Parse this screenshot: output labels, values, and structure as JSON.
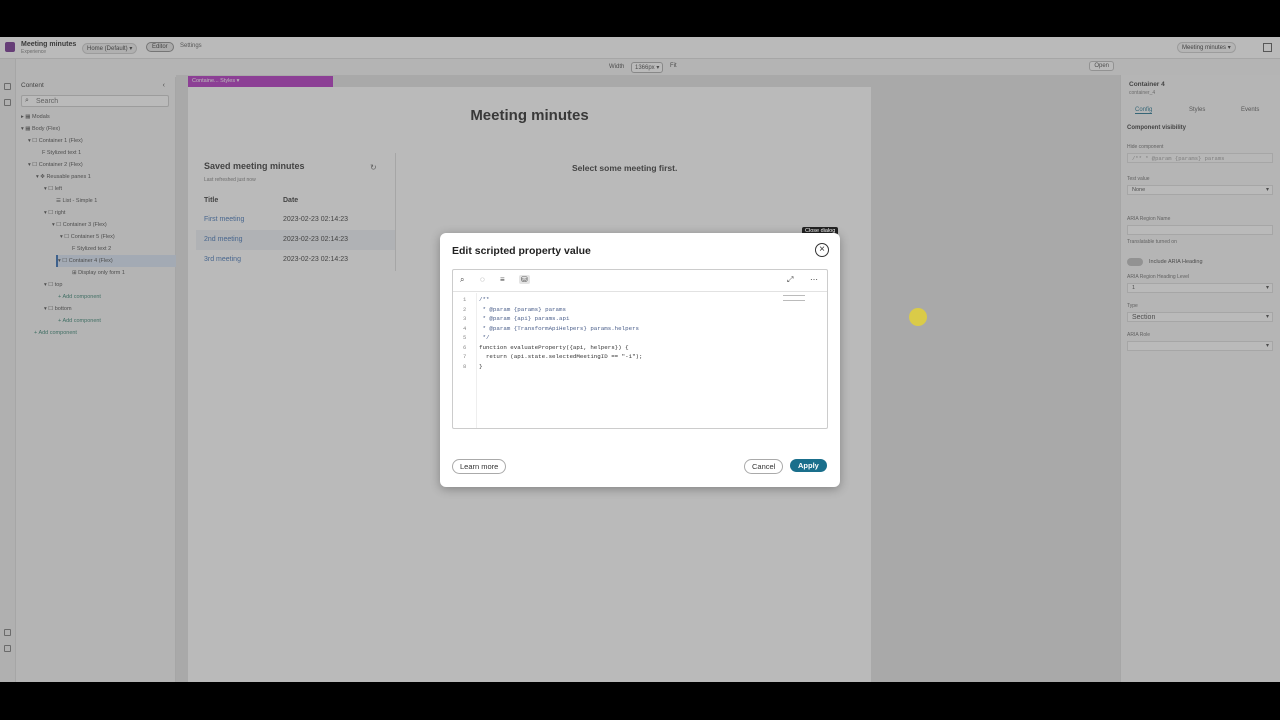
{
  "topbar": {
    "app_title": "Meeting minutes",
    "app_sub": "Experience",
    "page_select": "Home (Default) ▾",
    "tab_editor": "Editor",
    "tab_settings": "Settings",
    "right_select": "Meeting minutes ▾"
  },
  "widthbar": {
    "label": "Width",
    "value": "1366px ▾",
    "fit": "Fit",
    "open": "Open"
  },
  "tree": {
    "header": "Content",
    "search_placeholder": "Search",
    "nodes": [
      "Modals",
      "Body (Flex)",
      "Container 1 (Flex)",
      "Stylized text 1",
      "Container 2 (Flex)",
      "Reusable panes 1",
      "left",
      "List - Simple 1",
      "right",
      "Container 3 (Flex)",
      "Container 5 (Flex)",
      "Stylized text 2",
      "Container 4 (Flex)",
      "Display only form 1",
      "top",
      "Add component",
      "bottom",
      "Add component",
      "Add component"
    ]
  },
  "canvas": {
    "sel_toolbar": "Containe...   Styles ▾",
    "page_title": "Meeting minutes",
    "saved_title": "Saved meeting minutes",
    "saved_sub": "Last refreshed just now",
    "col_title": "Title",
    "col_date": "Date",
    "rows": [
      {
        "title": "First meeting",
        "date": "2023-02-23 02:14:23"
      },
      {
        "title": "2nd meeting",
        "date": "2023-02-23 02:14:23"
      },
      {
        "title": "3rd meeting",
        "date": "2023-02-23 02:14:23"
      }
    ],
    "select_msg": "Select some meeting first."
  },
  "rpanel": {
    "title": "Container 4",
    "sub": "container_4",
    "tabs": [
      "Config",
      "Styles",
      "Events"
    ],
    "section": "Component visibility",
    "hide_label": "Hide component",
    "hide_value": "/** * @param {params} params",
    "test_label": "Test value",
    "test_value": "None",
    "aria_region_label": "ARIA Region Name",
    "translatable": "Translatable turned on",
    "include_heading": "Include ARIA Heading",
    "heading_level_label": "ARIA Region Heading Level",
    "heading_level_value": "1",
    "type_label": "Type",
    "type_value": "Section",
    "aria_role_label": "ARIA Role",
    "aria_role_value": ""
  },
  "dialog": {
    "title": "Edit scripted property value",
    "close_tooltip": "Close dialog",
    "code_lines": [
      "/**",
      " * @param {params} params",
      " * @param {api} params.api",
      " * @param {TransformApiHelpers} params.helpers",
      " */",
      "function evaluateProperty({api, helpers}) {",
      "  return (api.state.selectedMeetingID == \"-1\");",
      "}"
    ],
    "learn_more": "Learn more",
    "cancel": "Cancel",
    "apply": "Apply"
  },
  "colors": {
    "accent": "#1a6f8c",
    "selection_toolbar": "#b02cc0",
    "link": "#3b6fb3"
  }
}
